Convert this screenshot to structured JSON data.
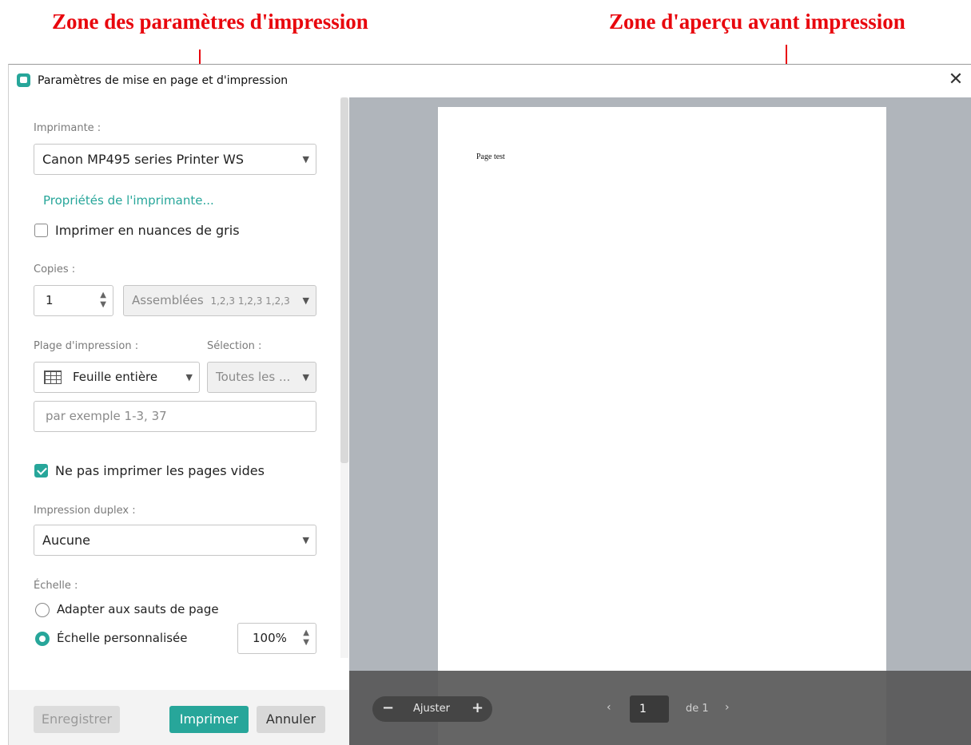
{
  "annotations": {
    "left": "Zone des paramètres d'impression",
    "right": "Zone d'aperçu avant impression"
  },
  "window": {
    "title": "Paramètres de mise en page et d'impression",
    "close_glyph": "✕"
  },
  "settings": {
    "printer_label": "Imprimante :",
    "printer_value": "Canon MP495 series Printer WS",
    "printer_properties_link": "Propriétés de l'imprimante...",
    "grayscale_label": "Imprimer en nuances de gris",
    "grayscale_checked": false,
    "copies_label": "Copies :",
    "copies_value": "1",
    "collate_value": "Assemblées",
    "collate_hint": "1,2,3 1,2,3 1,2,3",
    "range_label": "Plage d'impression :",
    "range_value": "Feuille entière",
    "selection_label": "Sélection :",
    "selection_value": "Toutes les ...",
    "pages_placeholder": "par exemple 1-3, 37",
    "skip_blank_label": "Ne pas imprimer les pages vides",
    "skip_blank_checked": true,
    "duplex_label": "Impression duplex :",
    "duplex_value": "Aucune",
    "scale_label": "Échelle :",
    "scale_fit_label": "Adapter aux sauts de page",
    "scale_custom_label": "Échelle personnalisée",
    "scale_value": "100%",
    "selected_scale_option": "custom"
  },
  "footer": {
    "save_label": "Enregistrer",
    "print_label": "Imprimer",
    "cancel_label": "Annuler"
  },
  "preview": {
    "page_text": "Page test",
    "zoom_label": "Ajuster",
    "current_page": "1",
    "page_of": "de 1"
  },
  "colors": {
    "accent": "#27a69a",
    "annotation": "#e8060d",
    "preview_bg": "#b0b5bb"
  }
}
